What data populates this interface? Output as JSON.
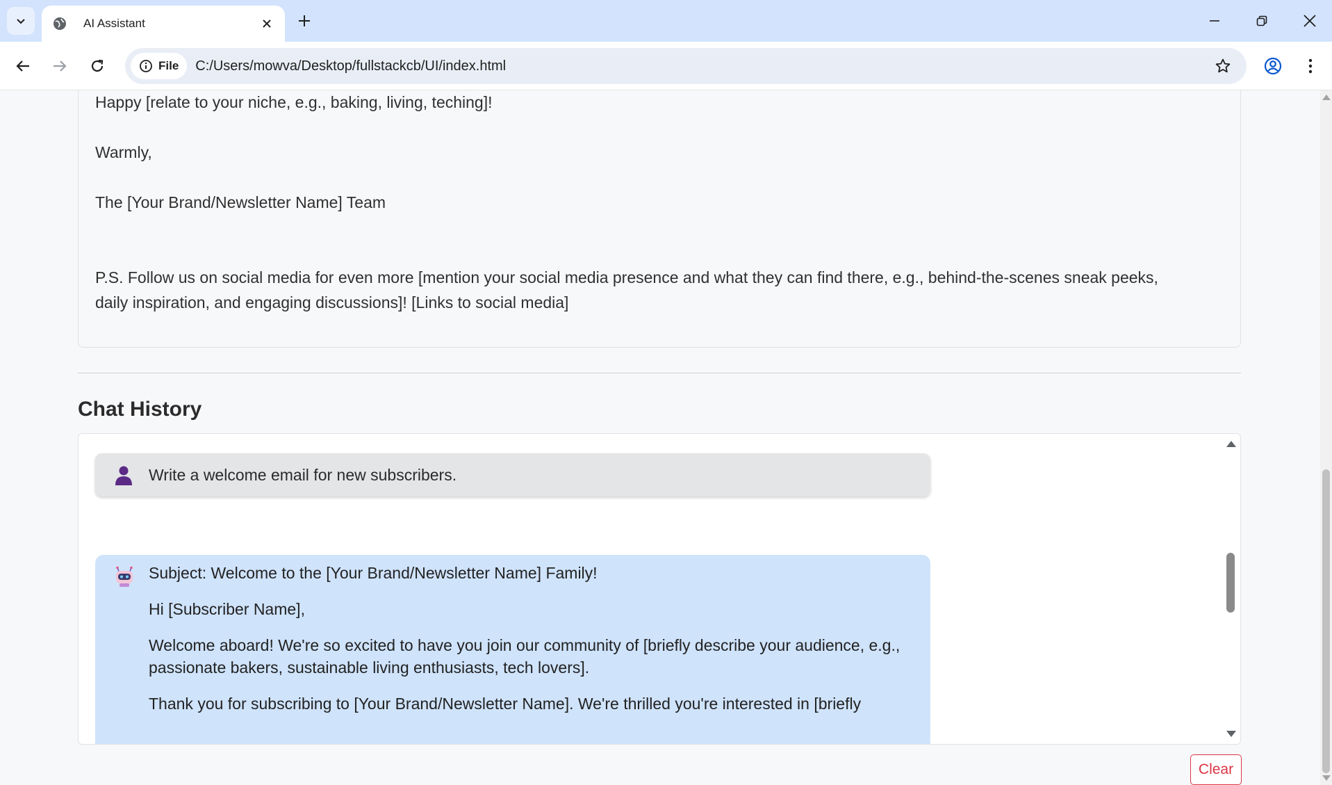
{
  "browser": {
    "tab_title": "AI Assistant",
    "site_chip_label": "File",
    "url": "C:/Users/mowva/Desktop/fullstackcb/UI/index.html"
  },
  "response": {
    "lines": [
      "Happy [relate to your niche, e.g., baking, living, teching]!",
      "Warmly,",
      "The [Your Brand/Newsletter Name] Team",
      "P.S.  Follow us on social media for even more [mention your social media presence and what they can find there, e.g., behind-the-scenes sneak peeks,",
      "daily inspiration, and engaging discussions]! [Links to social media]"
    ]
  },
  "chat_history": {
    "title": "Chat History",
    "user_message": "Write a welcome email for new subscribers.",
    "bot_lines": [
      "Subject: Welcome to the [Your Brand/Newsletter Name] Family!",
      "Hi [Subscriber Name],",
      "Welcome aboard! We're so excited to have you join our community of [briefly describe your audience, e.g.,",
      "passionate bakers, sustainable living enthusiasts, tech lovers].",
      "Thank you for subscribing to [Your Brand/Newsletter Name].  We're thrilled you're interested in [briefly"
    ]
  },
  "actions": {
    "clear_label": "Clear"
  },
  "colors": {
    "tabbar": "#d3e3fd",
    "user_bubble": "#e4e5e7",
    "bot_bubble": "#cfe3fb",
    "clear_button": "#dc3545"
  },
  "icons": {
    "user_avatar": "person-icon",
    "bot_avatar": "robot-icon"
  }
}
